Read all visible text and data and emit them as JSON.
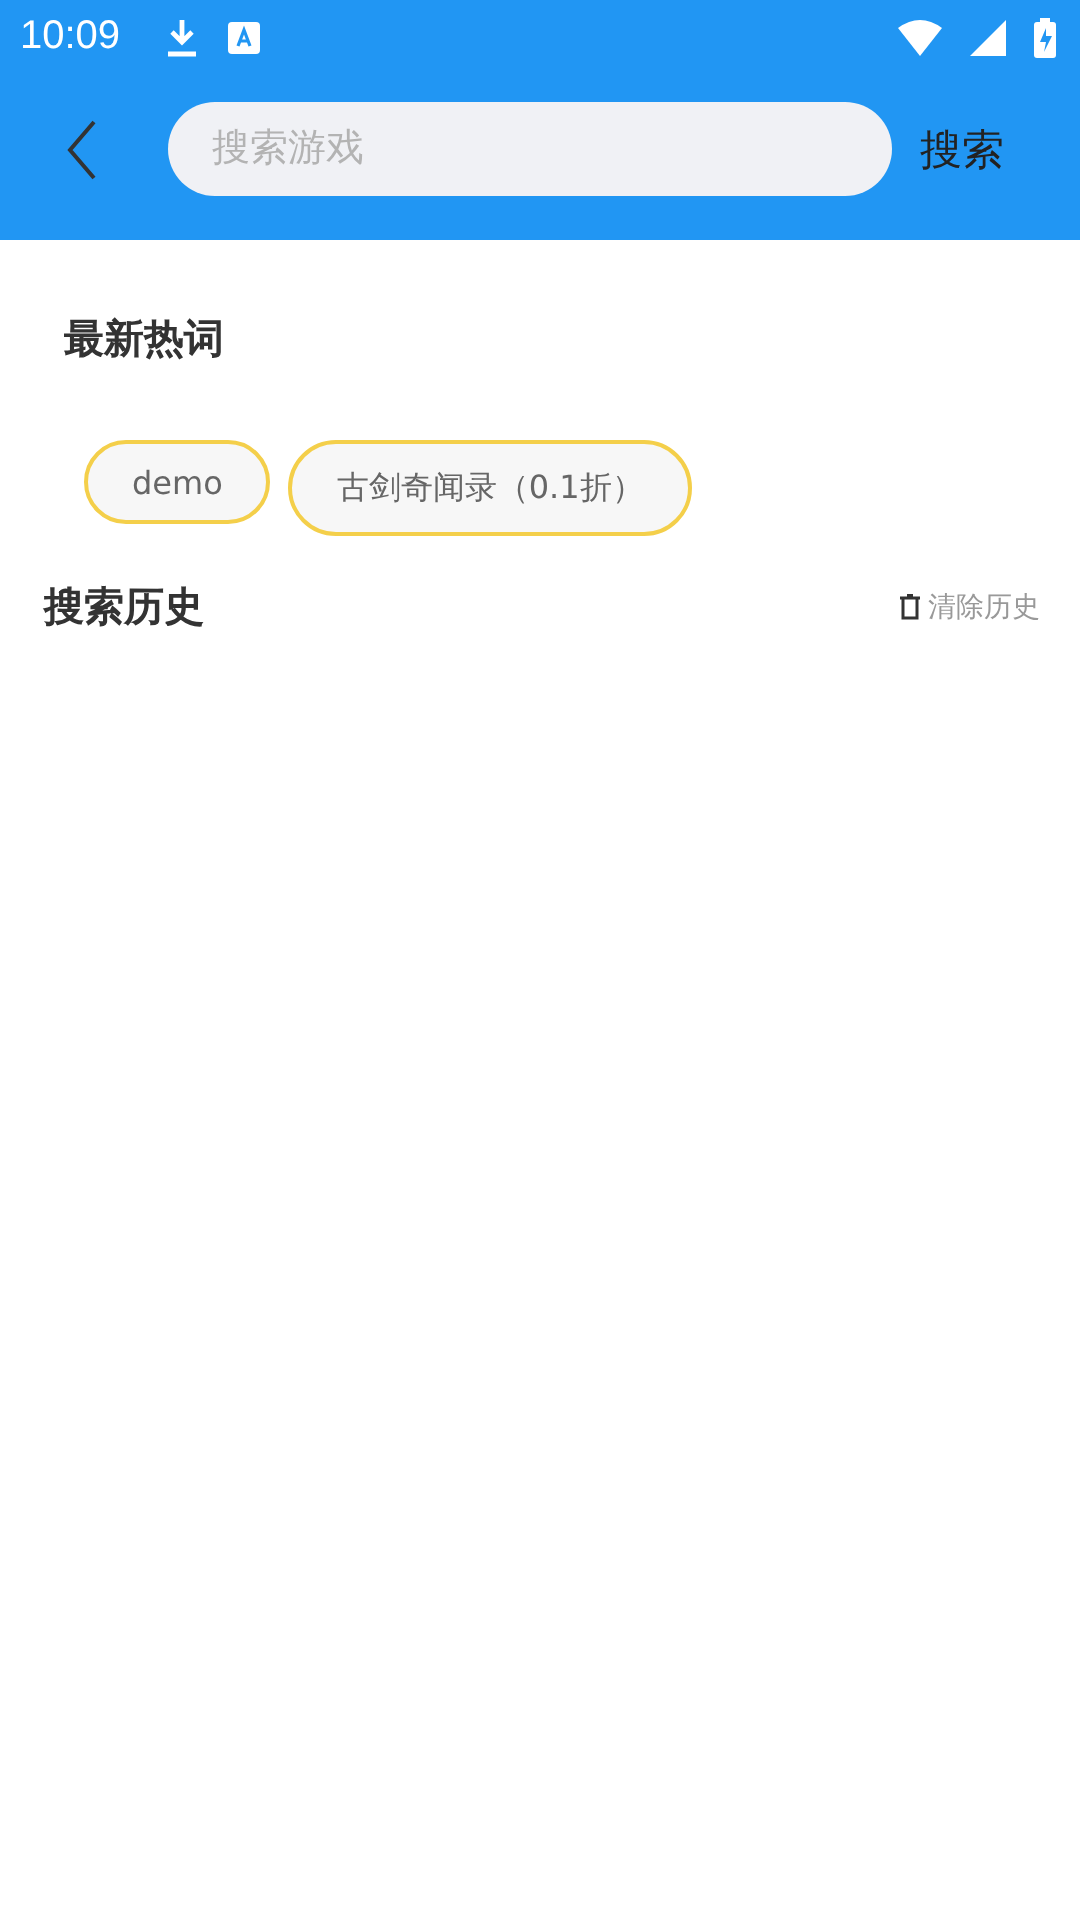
{
  "status_bar": {
    "time": "10:09"
  },
  "toolbar": {
    "search": {
      "placeholder": "搜索游戏"
    },
    "search_button": "搜索"
  },
  "hot_words": {
    "title": "最新热词",
    "tags": [
      "demo",
      "古剑奇闻录（0.1折）"
    ]
  },
  "history": {
    "title": "搜索历史",
    "clear": "清除历史"
  }
}
